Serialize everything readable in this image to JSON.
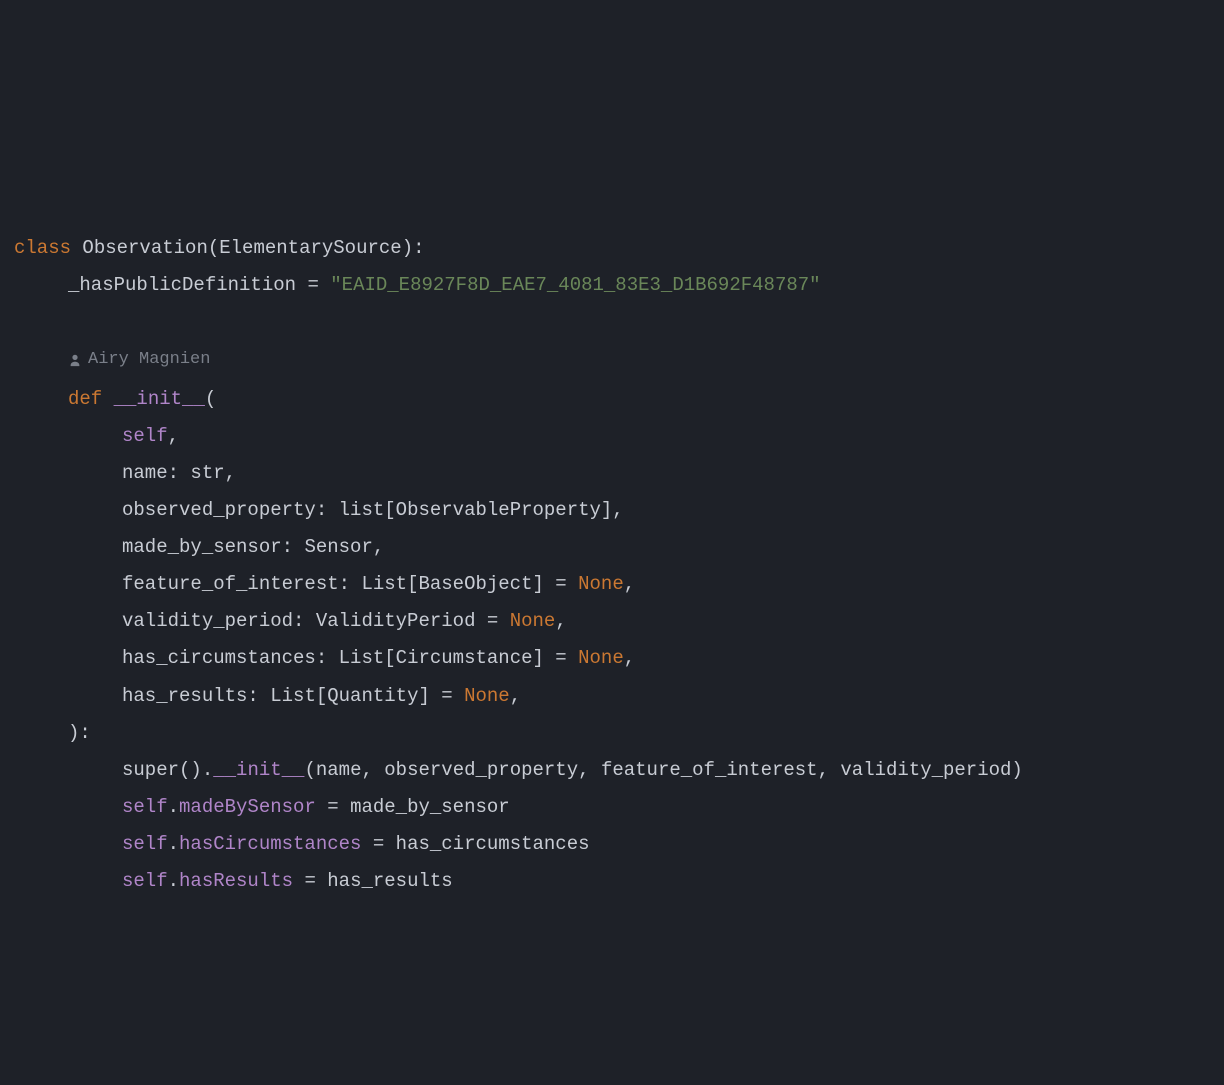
{
  "author_hint": "Airy Magnien",
  "colors": {
    "background": "#1e2128",
    "keyword": "#cb7832",
    "function": "#b085c9",
    "self": "#b085c9",
    "string": "#6a8759",
    "text": "#c8ccd4",
    "hint": "#7a7f89"
  },
  "code": {
    "class_kw": "class",
    "class_name": "Observation",
    "base_class": "ElementarySource",
    "attr_name": "_hasPublicDefinition",
    "attr_value": "\"EAID_E8927F8D_EAE7_4081_83E3_D1B692F48787\"",
    "def_kw": "def",
    "init_name": "__init__",
    "params": {
      "self": "self",
      "p1_name": "name",
      "p1_type": "str",
      "p2_name": "observed_property",
      "p2_type_outer": "list",
      "p2_type_inner": "ObservableProperty",
      "p3_name": "made_by_sensor",
      "p3_type": "Sensor",
      "p4_name": "feature_of_interest",
      "p4_type_outer": "List",
      "p4_type_inner": "BaseObject",
      "p4_default": "None",
      "p5_name": "validity_period",
      "p5_type": "ValidityPeriod",
      "p5_default": "None",
      "p6_name": "has_circumstances",
      "p6_type_outer": "List",
      "p6_type_inner": "Circumstance",
      "p6_default": "None",
      "p7_name": "has_results",
      "p7_type_outer": "List",
      "p7_type_inner": "Quantity",
      "p7_default": "None"
    },
    "body": {
      "super_call": "super",
      "super_init": "__init__",
      "super_args": [
        "name",
        "observed_property",
        "feature_of_interest",
        "validity_period"
      ],
      "assign1_lhs": "madeBySensor",
      "assign1_rhs": "made_by_sensor",
      "assign2_lhs": "hasCircumstances",
      "assign2_rhs": "has_circumstances",
      "assign3_lhs": "hasResults",
      "assign3_rhs": "has_results"
    }
  }
}
